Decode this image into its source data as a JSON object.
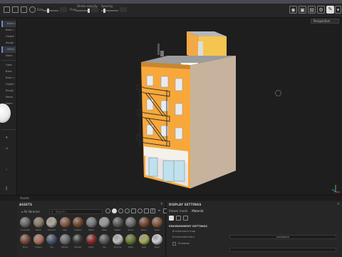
{
  "app": {
    "viewport_label": "Perspective",
    "accent_color": "#6d8cc9"
  },
  "toolbar": {
    "left_labels": [
      "Size",
      "Flow",
      "Stroke opacity",
      "Spacing"
    ],
    "values": [
      "",
      "",
      "",
      ""
    ]
  },
  "sidebar": {
    "items": [
      {
        "label": "Base c"
      },
      {
        "label": "Base c"
      },
      {
        "label": "Height"
      },
      {
        "label": "Rough"
      },
      {
        "label": "Metal"
      },
      {
        "label": "Norm"
      },
      {
        "label": "Opac"
      },
      {
        "label": "Base"
      },
      {
        "label": "Base c"
      },
      {
        "label": "Height"
      },
      {
        "label": "Rough"
      },
      {
        "label": "Metal"
      },
      {
        "label": "Norm"
      },
      {
        "label": "Base c"
      },
      {
        "label": "Height"
      },
      {
        "label": "Rough"
      }
    ]
  },
  "bottom": {
    "strip_label": "Assets"
  },
  "assets": {
    "title": "ASSETS",
    "filter_label": "All libraries",
    "search_placeholder": "Search...",
    "tiles": [
      {
        "label": "Concrete",
        "color": "#6a6a6a"
      },
      {
        "label": "Fabric",
        "color": "#8a7a6a"
      },
      {
        "label": "Ceramic",
        "color": "#b0a89c"
      },
      {
        "label": "Clay",
        "color": "#8a5a40"
      },
      {
        "label": "Leather",
        "color": "#7a4a2c"
      },
      {
        "label": "Metal",
        "color": "#7a7a7a"
      },
      {
        "label": "Steel",
        "color": "#9a9a9a"
      },
      {
        "label": "Plastic",
        "color": "#5a5a5a"
      },
      {
        "label": "Stone",
        "color": "#6e6e6e"
      },
      {
        "label": "Wood",
        "color": "#7a4a30"
      },
      {
        "label": "Rust",
        "color": "#8a5a3c"
      },
      {
        "label": "Brick",
        "color": "#7a4a3a"
      },
      {
        "label": "Copper",
        "color": "#b06e5a"
      },
      {
        "label": "Tile",
        "color": "#4a5570"
      },
      {
        "label": "Marble",
        "color": "#6b6e75"
      },
      {
        "label": "Rubber",
        "color": "#3a3a3a"
      },
      {
        "label": "Paint",
        "color": "#8a2a2a"
      },
      {
        "label": "Iron",
        "color": "#5a5a5a"
      },
      {
        "label": "Chrome",
        "color": "#bdbdbd"
      },
      {
        "label": "Moss",
        "color": "#6a7a2a"
      },
      {
        "label": "Gold",
        "color": "#a8a858"
      },
      {
        "label": "Silver",
        "color": "#cfcfcf"
      }
    ]
  },
  "display": {
    "title": "DISPLAY SETTINGS",
    "tabs": [
      "Viewer mode",
      "Material"
    ],
    "section": "ENVIRONMENT SETTINGS",
    "rows": [
      {
        "label": "Environment map",
        "value": ""
      },
      {
        "label": "Environment blur",
        "value": "panorama"
      },
      {
        "label": "Shadows",
        "value": ""
      },
      {
        "label": "Rotation",
        "value": ""
      }
    ]
  }
}
